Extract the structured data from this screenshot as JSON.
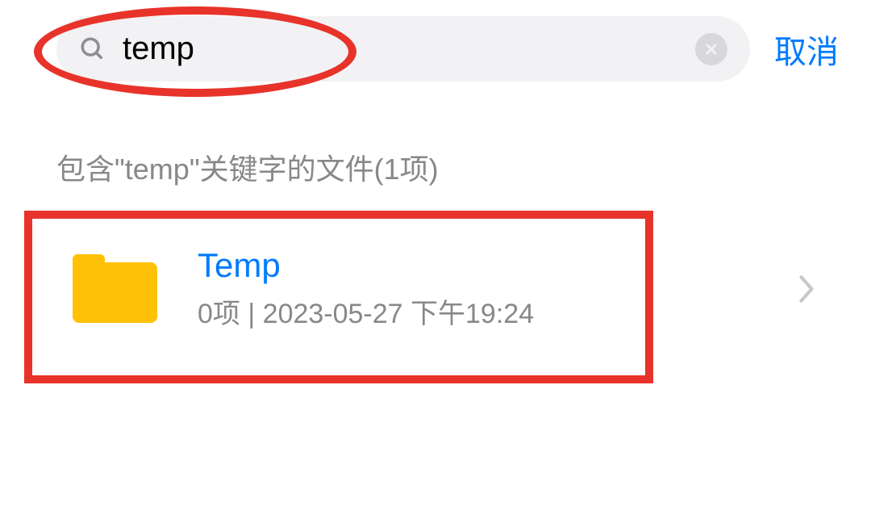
{
  "search": {
    "query": "temp",
    "placeholder": ""
  },
  "header": {
    "cancel_label": "取消"
  },
  "results": {
    "header_text": "包含\"temp\"关键字的文件(1项)",
    "items": [
      {
        "title": "Temp",
        "item_count": "0项",
        "separator": "  |  ",
        "timestamp": "2023-05-27 下午19:24"
      }
    ]
  }
}
